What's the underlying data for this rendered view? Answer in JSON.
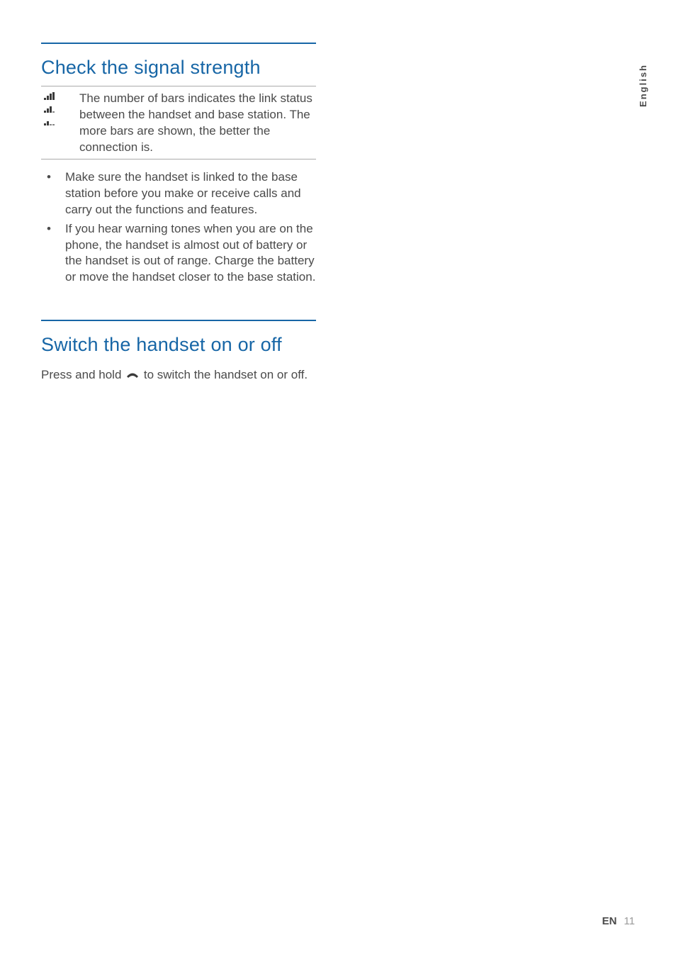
{
  "language_tab": "English",
  "section1": {
    "heading": "Check the signal strength",
    "table_text": "The number of bars indicates the link status between the handset and base station. The more bars are shown, the better the connection is.",
    "bullets": [
      "Make sure the handset is linked to the base station before you make or receive calls and carry out the functions and features.",
      "If you hear warning tones when you are on the phone, the handset is almost out of battery or the handset is out of range. Charge the battery or move the handset closer to the base station."
    ]
  },
  "section2": {
    "heading": "Switch the handset on or off",
    "para_before": "Press and hold ",
    "para_after": " to switch the handset on or off."
  },
  "footer": {
    "lang": "EN",
    "page": "11"
  }
}
